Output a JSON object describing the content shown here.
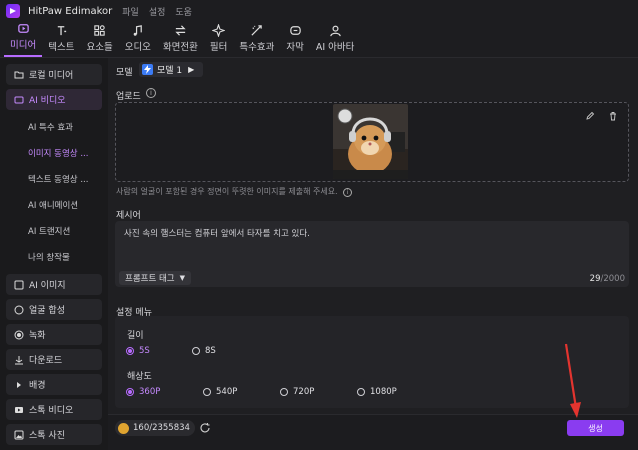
{
  "app": {
    "title": "HitPaw Edimakor",
    "menus": [
      "파일",
      "설정",
      "도움"
    ]
  },
  "toolbar": [
    {
      "label": "미디어",
      "icon": "media-icon",
      "active": true
    },
    {
      "label": "텍스트",
      "icon": "text-icon"
    },
    {
      "label": "요소들",
      "icon": "elements-icon"
    },
    {
      "label": "오디오",
      "icon": "audio-icon"
    },
    {
      "label": "화면전환",
      "icon": "transition-icon"
    },
    {
      "label": "필터",
      "icon": "filter-icon"
    },
    {
      "label": "특수효과",
      "icon": "effects-icon"
    },
    {
      "label": "자막",
      "icon": "subtitle-icon"
    },
    {
      "label": "AI 아바타",
      "icon": "avatar-icon"
    }
  ],
  "sidebar": {
    "local_media": "로컬 미디어",
    "ai_video": "AI 비디오",
    "sub": [
      "AI 특수 효과",
      "이미지 동영상 ...",
      "텍스트 동영상 ...",
      "AI 애니메이션",
      "AI 트랜지션",
      "나의 창작물"
    ],
    "ai_image": "AI 이미지",
    "face_swap": "얼굴 합성",
    "record": "녹화",
    "download": "다운로드",
    "background": "배경",
    "stock_video": "스톡 비디오",
    "stock_photo": "스톡 사진"
  },
  "main": {
    "model_label": "모델",
    "model_value": "모델 1",
    "upload_label": "업로드",
    "upload_notice": "사람의 얼굴이 포함된 경우 정면이 뚜렷한 이미지를 제출해 주세요.",
    "prompt_label": "제시어",
    "prompt_text": "사진 속의 햄스터는 컴퓨터 앞에서 타자를 치고 있다.",
    "prompt_tag": "프롬프트 태그",
    "count_current": "29",
    "count_max": "/2000",
    "settings_label": "설정 메뉴",
    "length_label": "길이",
    "length_options": [
      "5S",
      "8S"
    ],
    "length_selected": "5S",
    "resolution_label": "해상도",
    "resolution_options": [
      "360P",
      "540P",
      "720P",
      "1080P"
    ],
    "resolution_selected": "360P",
    "credits": "160/2355834",
    "generate": "생성"
  },
  "colors": {
    "accent": "#b76cff",
    "button": "#8a3cf0",
    "arrow": "#e3342f"
  }
}
